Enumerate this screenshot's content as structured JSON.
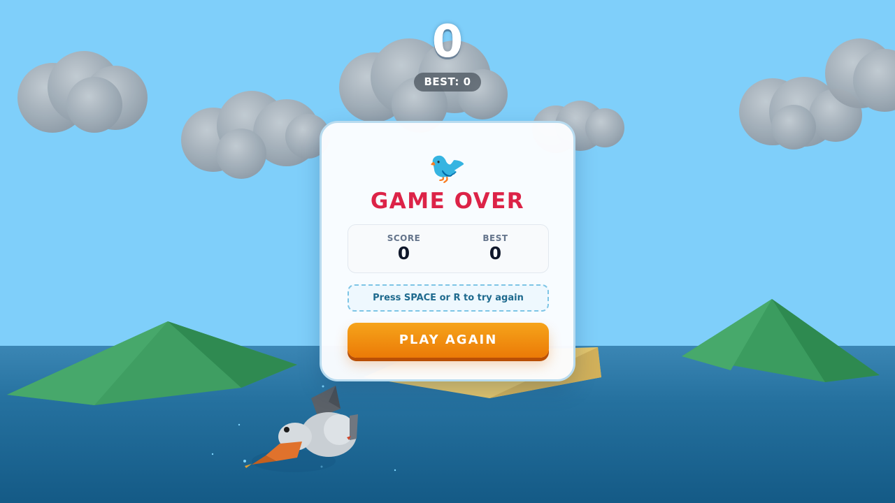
{
  "hud": {
    "score": "0",
    "best": "BEST: 0"
  },
  "game_over": {
    "icon": "bird-icon",
    "icon_glyph": "🐦",
    "title": "GAME OVER",
    "score_label": "SCORE",
    "score_value": "0",
    "best_label": "BEST",
    "best_value": "0",
    "hint": "Press SPACE or R to try again",
    "play_again_label": "PLAY AGAIN"
  },
  "colors": {
    "sky": "#7fcffa",
    "ocean": "#1f6fa0",
    "title_red": "#dc2347",
    "button_orange": "#f0900f",
    "island_green": "#3a9a5e",
    "sand": "#e3c56c"
  }
}
